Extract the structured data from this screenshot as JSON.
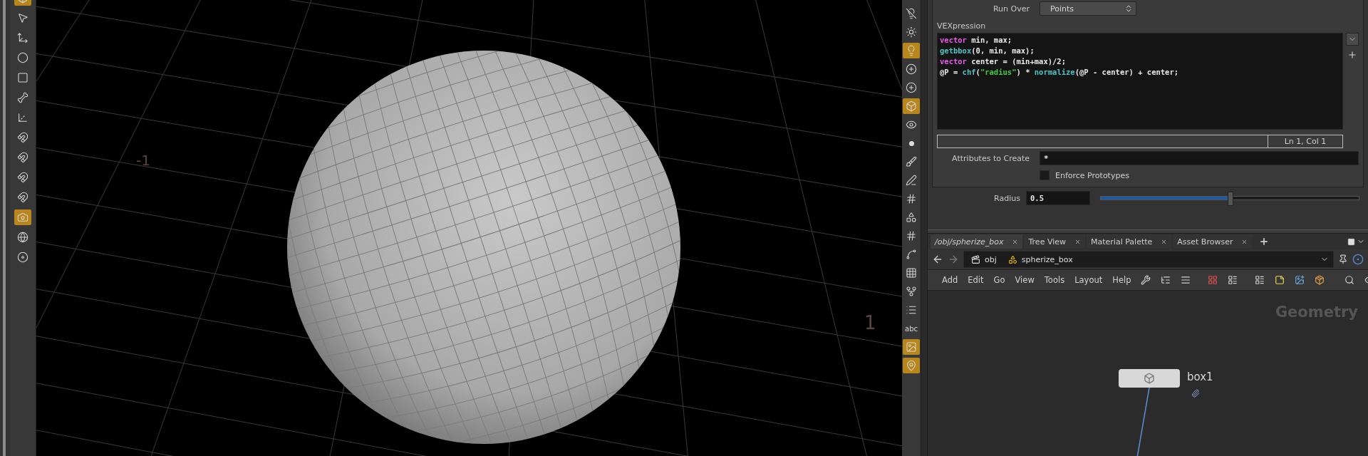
{
  "left_toolbar": {
    "tools": [
      {
        "kind": "cube",
        "selected": true
      },
      {
        "kind": "pointer",
        "selected": false
      },
      {
        "kind": "move",
        "selected": false
      },
      {
        "kind": "sphere",
        "selected": false
      },
      {
        "kind": "box",
        "selected": false
      },
      {
        "kind": "bone",
        "selected": false
      },
      {
        "kind": "axis",
        "selected": false
      },
      {
        "kind": "magnet",
        "selected": false
      },
      {
        "kind": "magnet",
        "selected": false
      },
      {
        "kind": "magnet",
        "selected": false
      },
      {
        "kind": "magnet",
        "selected": false
      },
      {
        "kind": "camera",
        "selected": true
      },
      {
        "kind": "globe",
        "selected": false
      },
      {
        "kind": "disc",
        "selected": false
      }
    ]
  },
  "viewport": {
    "axis_labels": [
      "-1",
      "1"
    ]
  },
  "right_toolbar": {
    "tools": [
      {
        "kind": "lightoff",
        "selected": false
      },
      {
        "kind": "sun",
        "selected": false
      },
      {
        "kind": "light",
        "selected": true
      },
      {
        "kind": "lightplus",
        "selected": false
      },
      {
        "kind": "lightplus",
        "selected": false
      },
      {
        "kind": "cube",
        "selected": true
      },
      {
        "kind": "eye",
        "selected": false
      },
      {
        "kind": "dot",
        "selected": false
      },
      {
        "kind": "brush",
        "selected": false
      },
      {
        "kind": "pen",
        "selected": false
      },
      {
        "kind": "hash",
        "selected": false
      },
      {
        "kind": "shapes",
        "selected": false
      },
      {
        "kind": "hash",
        "selected": false
      },
      {
        "kind": "spline",
        "selected": false
      },
      {
        "kind": "grid",
        "selected": false
      },
      {
        "kind": "fork",
        "selected": false
      },
      {
        "kind": "list",
        "selected": false
      },
      {
        "kind": "text",
        "label": "abc",
        "selected": false
      },
      {
        "kind": "image",
        "selected": true
      },
      {
        "kind": "pin",
        "selected": true
      }
    ]
  },
  "parameters": {
    "run_over": {
      "label": "Run Over",
      "value": "Points"
    },
    "vexpression": {
      "label": "VEXpression",
      "lines": [
        [
          {
            "kind": "keyword",
            "text": "vector"
          },
          {
            "kind": "plain",
            "text": " min, max;"
          }
        ],
        [
          {
            "kind": "function",
            "text": "getbbox"
          },
          {
            "kind": "plain",
            "text": "(0, min, max);"
          }
        ],
        [
          {
            "kind": "keyword",
            "text": "vector"
          },
          {
            "kind": "plain",
            "text": " center = (min+max)/2;"
          }
        ],
        [
          {
            "kind": "plain",
            "text": "@P = "
          },
          {
            "kind": "function",
            "text": "chf"
          },
          {
            "kind": "plain",
            "text": "("
          },
          {
            "kind": "string",
            "text": "\"radius\""
          },
          {
            "kind": "plain",
            "text": ") * "
          },
          {
            "kind": "function",
            "text": "normalize"
          },
          {
            "kind": "plain",
            "text": "(@P - center) + center;"
          }
        ]
      ]
    },
    "status": "Ln 1, Col 1",
    "attributes": {
      "label": "Attributes to Create",
      "value": "*"
    },
    "enforce": {
      "label": "Enforce Prototypes",
      "checked": false
    },
    "radius": {
      "label": "Radius",
      "value": "0.5",
      "level": 0.5
    }
  },
  "network": {
    "tabs": [
      {
        "label": "/obj/spherize_box",
        "selected": true
      },
      {
        "label": "Tree View",
        "selected": false
      },
      {
        "label": "Material Palette",
        "selected": false
      },
      {
        "label": "Asset Browser",
        "selected": false
      }
    ],
    "path": [
      "obj",
      "spherize_box"
    ],
    "menu": [
      "Add",
      "Edit",
      "Go",
      "View",
      "Tools",
      "Layout",
      "Help"
    ],
    "context": "Geometry",
    "node": {
      "name": "box1"
    }
  }
}
